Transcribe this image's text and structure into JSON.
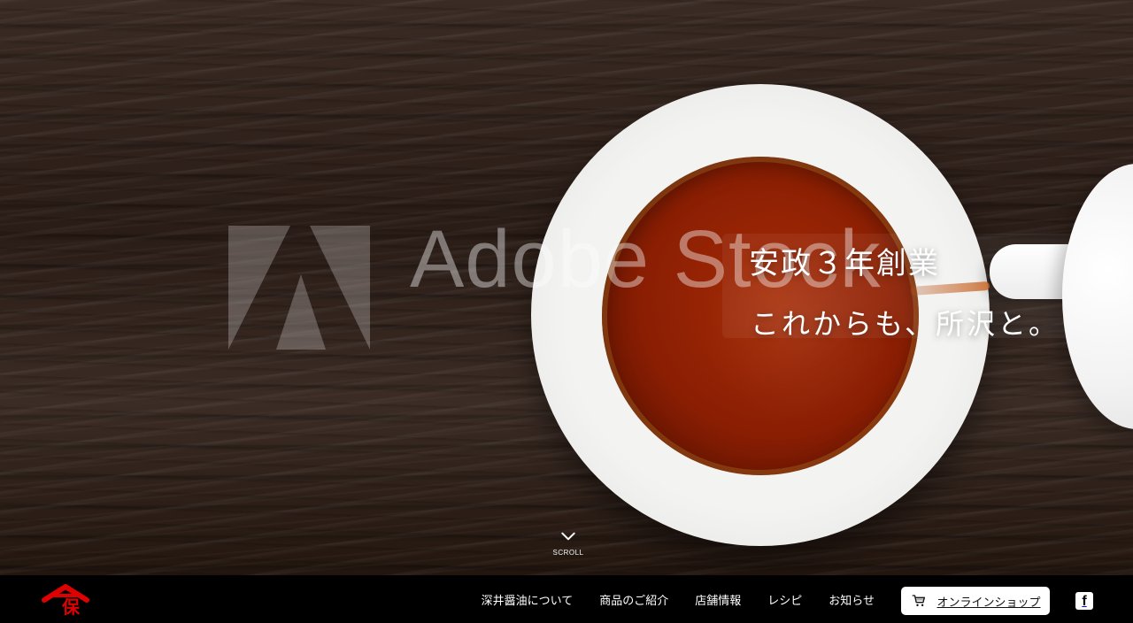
{
  "hero": {
    "heading_line1": "安政３年創業",
    "heading_line2": "これからも、所沢と。",
    "scroll_label": "SCROLL",
    "watermark_text": "Adobe Stock"
  },
  "nav": {
    "brand_mark": "保",
    "items": [
      {
        "label": "深井醤油について"
      },
      {
        "label": "商品のご紹介"
      },
      {
        "label": "店舗情報"
      },
      {
        "label": "レシピ"
      },
      {
        "label": "お知らせ"
      }
    ],
    "shop_button_label": "オンラインショップ",
    "social_icon": "facebook-icon"
  },
  "colors": {
    "nav_bg": "#000000",
    "brand_red": "#e00000",
    "accent_white": "#ffffff"
  }
}
